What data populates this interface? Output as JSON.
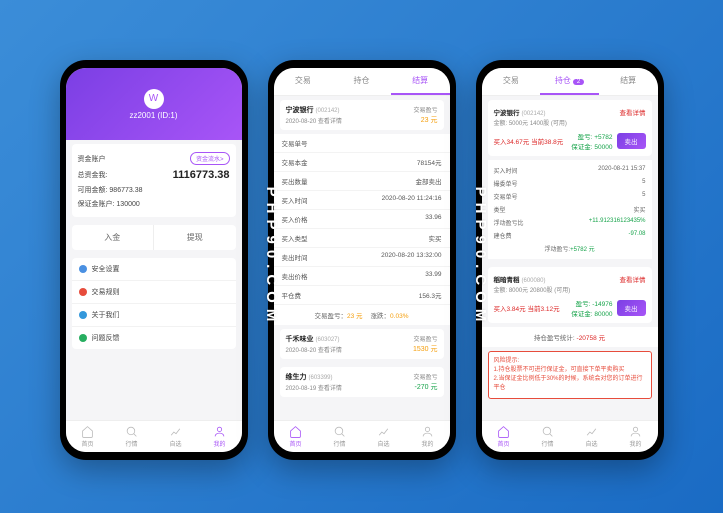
{
  "watermark": "PHP90.COM",
  "phone1": {
    "user": "zz2001",
    "idLabel": "(ID:1)",
    "acctTitle": "资金账户",
    "flowBtn": "资金流水>",
    "totalLabel": "总资金我:",
    "totalValue": "1116773.38",
    "availLabel": "可用金额:",
    "availValue": "986773.38",
    "marginLabel": "保证金账户:",
    "marginValue": "130000",
    "deposit": "入金",
    "withdraw": "提现",
    "menu": {
      "security": "安全设置",
      "rules": "交易规则",
      "about": "关于我们",
      "feedback": "问题反馈"
    }
  },
  "tabs": {
    "trade": "交易",
    "hold": "持仓",
    "settle": "结算"
  },
  "phone2": {
    "items": [
      {
        "name": "宁波银行",
        "code": "(002142)",
        "date": "2020-08-20 查看详情",
        "plLabel": "交易盈亏",
        "pl": "23 元",
        "plClass": "pl-orange"
      },
      {
        "name": "千禾味业",
        "code": "(603027)",
        "date": "2020-08-20 查看详情",
        "plLabel": "交易盈亏",
        "pl": "1530 元",
        "plClass": "pl-orange"
      },
      {
        "name": "维生力",
        "code": "(603399)",
        "date": "2020-08-19 查看详情",
        "plLabel": "交易盈亏",
        "pl": "-270 元",
        "plClass": "pl-green"
      }
    ],
    "details": [
      [
        "交易单号",
        ""
      ],
      [
        "交易本金",
        "78154元"
      ],
      [
        "买出数量",
        "金部卖出"
      ],
      [
        "买入时间",
        "2020-08-20 11:24:16"
      ],
      [
        "买入价格",
        "33.96"
      ],
      [
        "买入类型",
        "实买"
      ],
      [
        "卖出时间",
        "2020-08-20 13:32:00"
      ],
      [
        "卖出价格",
        "33.99"
      ],
      [
        "平仓费",
        "156.3元"
      ]
    ],
    "summaryPl": "交易盈亏：",
    "summaryPlVal": "23 元",
    "summaryRate": "涨跌：",
    "summaryRateVal": "0.03%"
  },
  "phone3": {
    "holdBadge": "2",
    "positions": [
      {
        "name": "宁波银行",
        "code": "(002142)",
        "detailBtn": "查看详情",
        "amount": "金额: 5000元  1400股 (可用)",
        "buy": "买入34.67元",
        "now": "当前38.8元",
        "plLabel": "盈亏:",
        "pl": "+5782",
        "marginLabel": "保证金:",
        "margin": "50000",
        "stats": [
          [
            "买入时间",
            "2020-08-21 15:37"
          ],
          [
            "撮委单号",
            "5"
          ],
          [
            "交易单号",
            "5"
          ],
          [
            "类型",
            "实买"
          ],
          [
            "浮动盈亏比",
            "+11.912316123435%",
            "pl-green"
          ],
          [
            "建仓费",
            "-97.08",
            "pl-green"
          ]
        ],
        "floatLabel": "浮动盈亏:",
        "floatVal": "+5782 元"
      },
      {
        "name": "稻暗青稻",
        "code": "(600080)",
        "detailBtn": "查看详情",
        "amount": "金额: 8000元  20800股 (可用)",
        "buy": "买入3.84元",
        "now": "当前3.12元",
        "plLabel": "盈亏:",
        "pl": "-14976",
        "marginLabel": "保证金:",
        "margin": "80000"
      }
    ],
    "totalLabel": "持仓盈亏统计:",
    "totalVal": "-20758 元",
    "warnTitle": "风险提示:",
    "warn1": "1.持仓股票不可进行保证金，可直接下单平卖购买",
    "warn2": "2.当保证金比例低于30%的时候，系统会对您的订单进行平仓",
    "sellBtn": "卖出"
  },
  "nav": {
    "home": "首页",
    "quote": "行情",
    "chart": "自选",
    "mine": "我的"
  }
}
